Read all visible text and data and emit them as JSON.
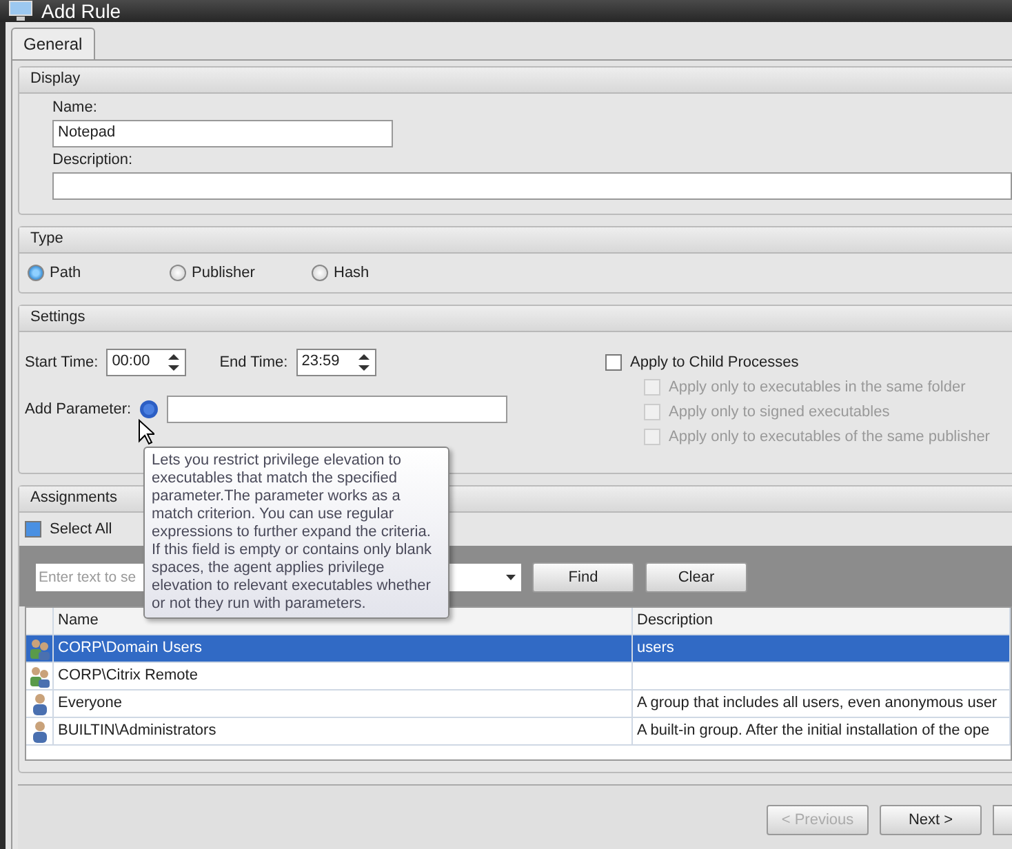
{
  "window": {
    "title": "Add Rule"
  },
  "tabs": [
    {
      "label": "General",
      "selected": true
    }
  ],
  "display": {
    "header": "Display",
    "name_label": "Name:",
    "name_value": "Notepad",
    "description_label": "Description:"
  },
  "type": {
    "header": "Type",
    "options": [
      {
        "label": "Path",
        "selected": true
      },
      {
        "label": "Publisher",
        "selected": false
      },
      {
        "label": "Hash",
        "selected": false
      }
    ]
  },
  "settings": {
    "header": "Settings",
    "start_label": "Start Time:",
    "start_value": "00:00",
    "end_label": "End Time:",
    "end_value": "23:59",
    "param_label": "Add Parameter:",
    "checks": [
      {
        "label": "Apply to Child Processes",
        "checked": false,
        "disabled": false
      },
      {
        "label": "Apply only to executables in the same folder",
        "checked": false,
        "disabled": true
      },
      {
        "label": "Apply only to signed executables",
        "checked": false,
        "disabled": true
      },
      {
        "label": "Apply only to executables of the same publisher",
        "checked": false,
        "disabled": true
      }
    ]
  },
  "tooltip": "Lets you restrict privilege elevation to executables that match the specified parameter.The parameter works as a match criterion. You can use regular expressions to further expand the criteria. If this field is empty or contains only blank spaces, the agent applies privilege elevation to relevant executables whether or not they run with parameters.",
  "assignments": {
    "header": "Assignments",
    "select_all": "Select All",
    "select_all_checked": true,
    "search_placeholder": "Enter text to se",
    "buttons": [
      "Find",
      "Clear"
    ],
    "columns": [
      "Name",
      "Description"
    ],
    "rows": [
      {
        "kind": "group",
        "name": "CORP\\Domain Users",
        "description": "users",
        "selected": true
      },
      {
        "kind": "group",
        "name": "CORP\\Citrix Remote",
        "description": "",
        "selected": false
      },
      {
        "kind": "user",
        "name": "Everyone",
        "description": "A group that includes all users, even anonymous user",
        "selected": false
      },
      {
        "kind": "user",
        "name": "BUILTIN\\Administrators",
        "description": "A built-in group. After the initial installation of the ope",
        "selected": false
      }
    ]
  },
  "footer": {
    "buttons": [
      {
        "label": "< Previous",
        "disabled": true
      },
      {
        "label": "Next >",
        "disabled": false
      }
    ]
  }
}
